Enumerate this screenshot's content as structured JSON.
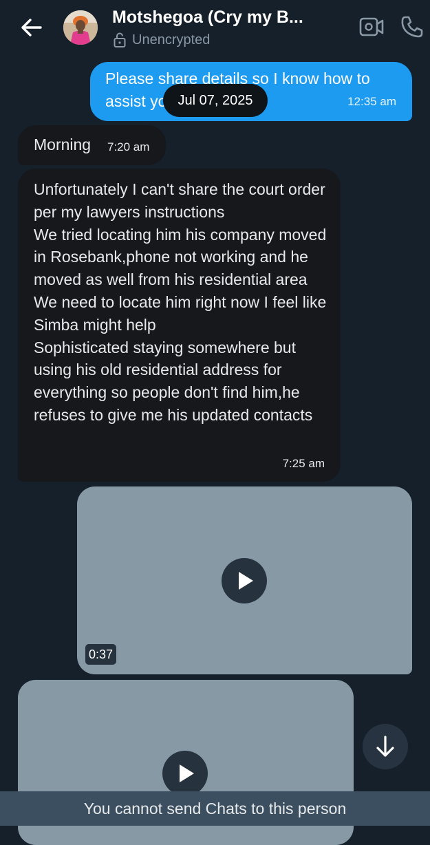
{
  "header": {
    "contact_name": "Motshegoa (Cry my B...",
    "encryption_status": "Unencrypted",
    "icons": {
      "back": "back-arrow-icon",
      "lock": "unlock-icon",
      "video": "video-call-icon",
      "call": "phone-icon"
    }
  },
  "messages": {
    "outgoing_1": {
      "text": "Please share details so I know how to assist you",
      "time": "12:35 am"
    },
    "date_divider": "Jul 07, 2025",
    "incoming_1": {
      "text": "Morning",
      "time": "7:20 am"
    },
    "incoming_2": {
      "text": "Unfortunately I can't share the court order per my lawyers instructions\nWe tried locating him his company moved in Rosebank,phone not working and he moved as well from his residential area\nWe need to locate him right now I feel like Simba might help\nSophisticated staying somewhere but using his old residential address for everything so people don't find him,he refuses to give me his updated contacts",
      "time": "7:25 am"
    },
    "video_1": {
      "duration": "0:37"
    }
  },
  "footer": {
    "notice": "You cannot send Chats to this person"
  },
  "colors": {
    "background": "#15202b",
    "outgoing_bubble": "#1d9bf0",
    "incoming_bubble": "#16181c",
    "video_placeholder": "#8899a6",
    "footer": "#3b4f61",
    "muted_text": "#8b98a5"
  }
}
